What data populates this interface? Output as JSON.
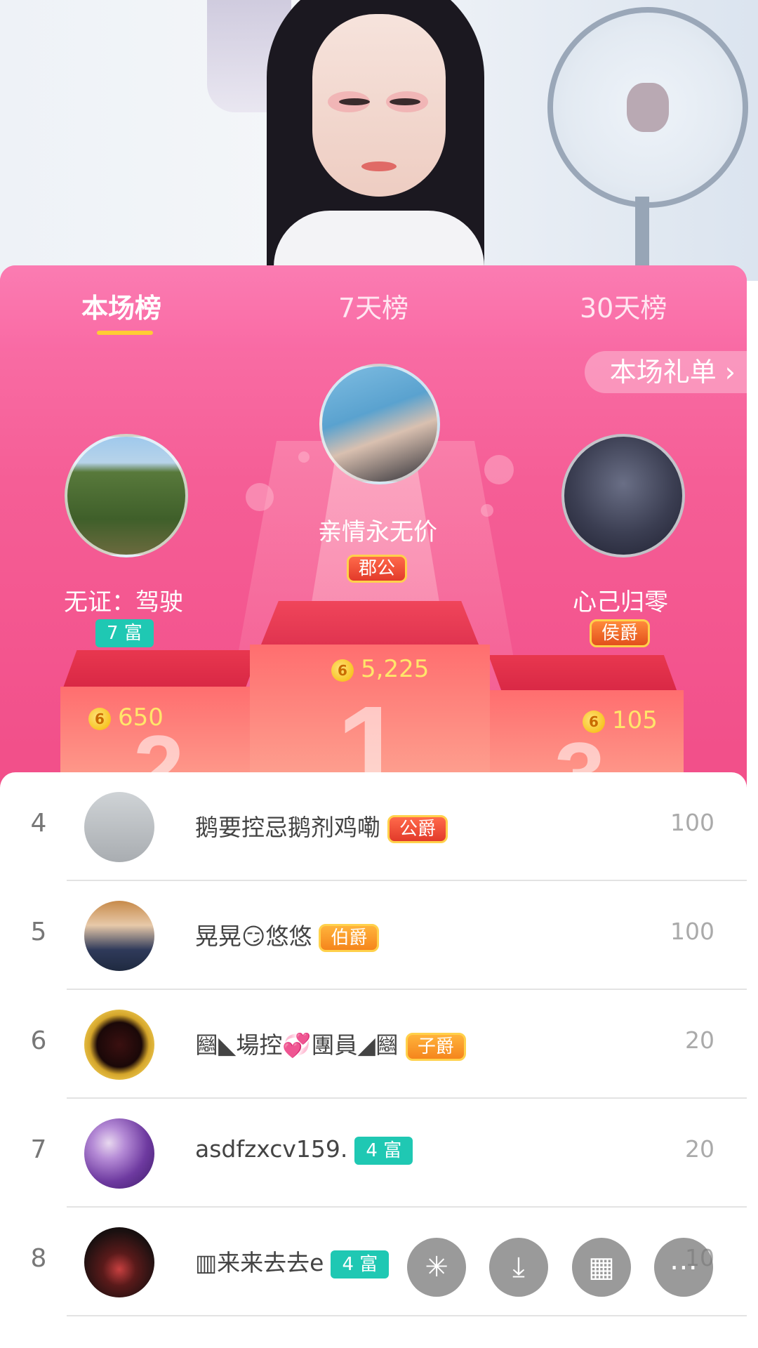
{
  "tabs": [
    {
      "label": "本场榜",
      "active": true
    },
    {
      "label": "7天榜",
      "active": false
    },
    {
      "label": "30天榜",
      "active": false
    }
  ],
  "gift_list_button": "本场礼单 ›",
  "top3": [
    {
      "rank": 1,
      "name": "亲情永无价",
      "badge": "郡公",
      "badge_type": "noble",
      "score": "5,225"
    },
    {
      "rank": 2,
      "name": "无证：驾驶",
      "badge": "7 富",
      "badge_type": "rich",
      "score": "650"
    },
    {
      "rank": 3,
      "name": "心己归零",
      "badge": "侯爵",
      "badge_type": "noble",
      "score": "105"
    }
  ],
  "podium_numbers": {
    "first": "1",
    "second": "2",
    "third": "3"
  },
  "coin_symbol": "6",
  "list": [
    {
      "rank": "4",
      "name": "鹅要控忌鹅剂鸡嘞",
      "badge": "公爵",
      "value": "100"
    },
    {
      "rank": "5",
      "name": "晃晃😏悠悠",
      "badge": "伯爵",
      "value": "100"
    },
    {
      "rank": "6",
      "name": "圝◣場控💞團員◢圝",
      "badge": "子爵",
      "value": "20"
    },
    {
      "rank": "7",
      "name": "asdfzxcv159.",
      "badge": "4 富",
      "value": "20"
    },
    {
      "rank": "8",
      "name": "▥来来去去e",
      "badge": "4 富",
      "value": "10"
    }
  ],
  "floating_buttons": [
    "share-icon",
    "download-icon",
    "grid-icon",
    "more-icon"
  ],
  "colors": {
    "panel_pink": "#f2508a",
    "tab_underline": "#ffcc33",
    "rich_badge": "#1fc8b3",
    "score_gold": "#ffe66a"
  }
}
